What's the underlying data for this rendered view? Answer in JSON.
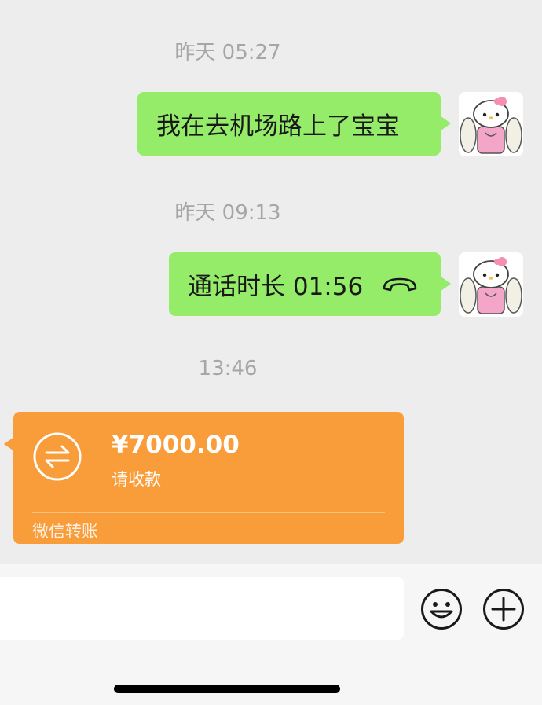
{
  "messages": [
    {
      "timestamp": "昨天 05:27",
      "text": "我在去机场路上了宝宝"
    },
    {
      "timestamp": "昨天 09:13",
      "text": "通话时长 01:56"
    },
    {
      "timestamp": "13:46"
    }
  ],
  "transfer": {
    "amount": "¥7000.00",
    "status": "请收款",
    "footer": "微信转账",
    "color": "#f99d3a"
  },
  "colors": {
    "bubble": "#95ec69",
    "background": "#ededed"
  },
  "input": {
    "placeholder": ""
  },
  "icons": [
    "phone-hangup-icon",
    "transfer-arrows-icon",
    "emoji-icon",
    "plus-icon"
  ]
}
